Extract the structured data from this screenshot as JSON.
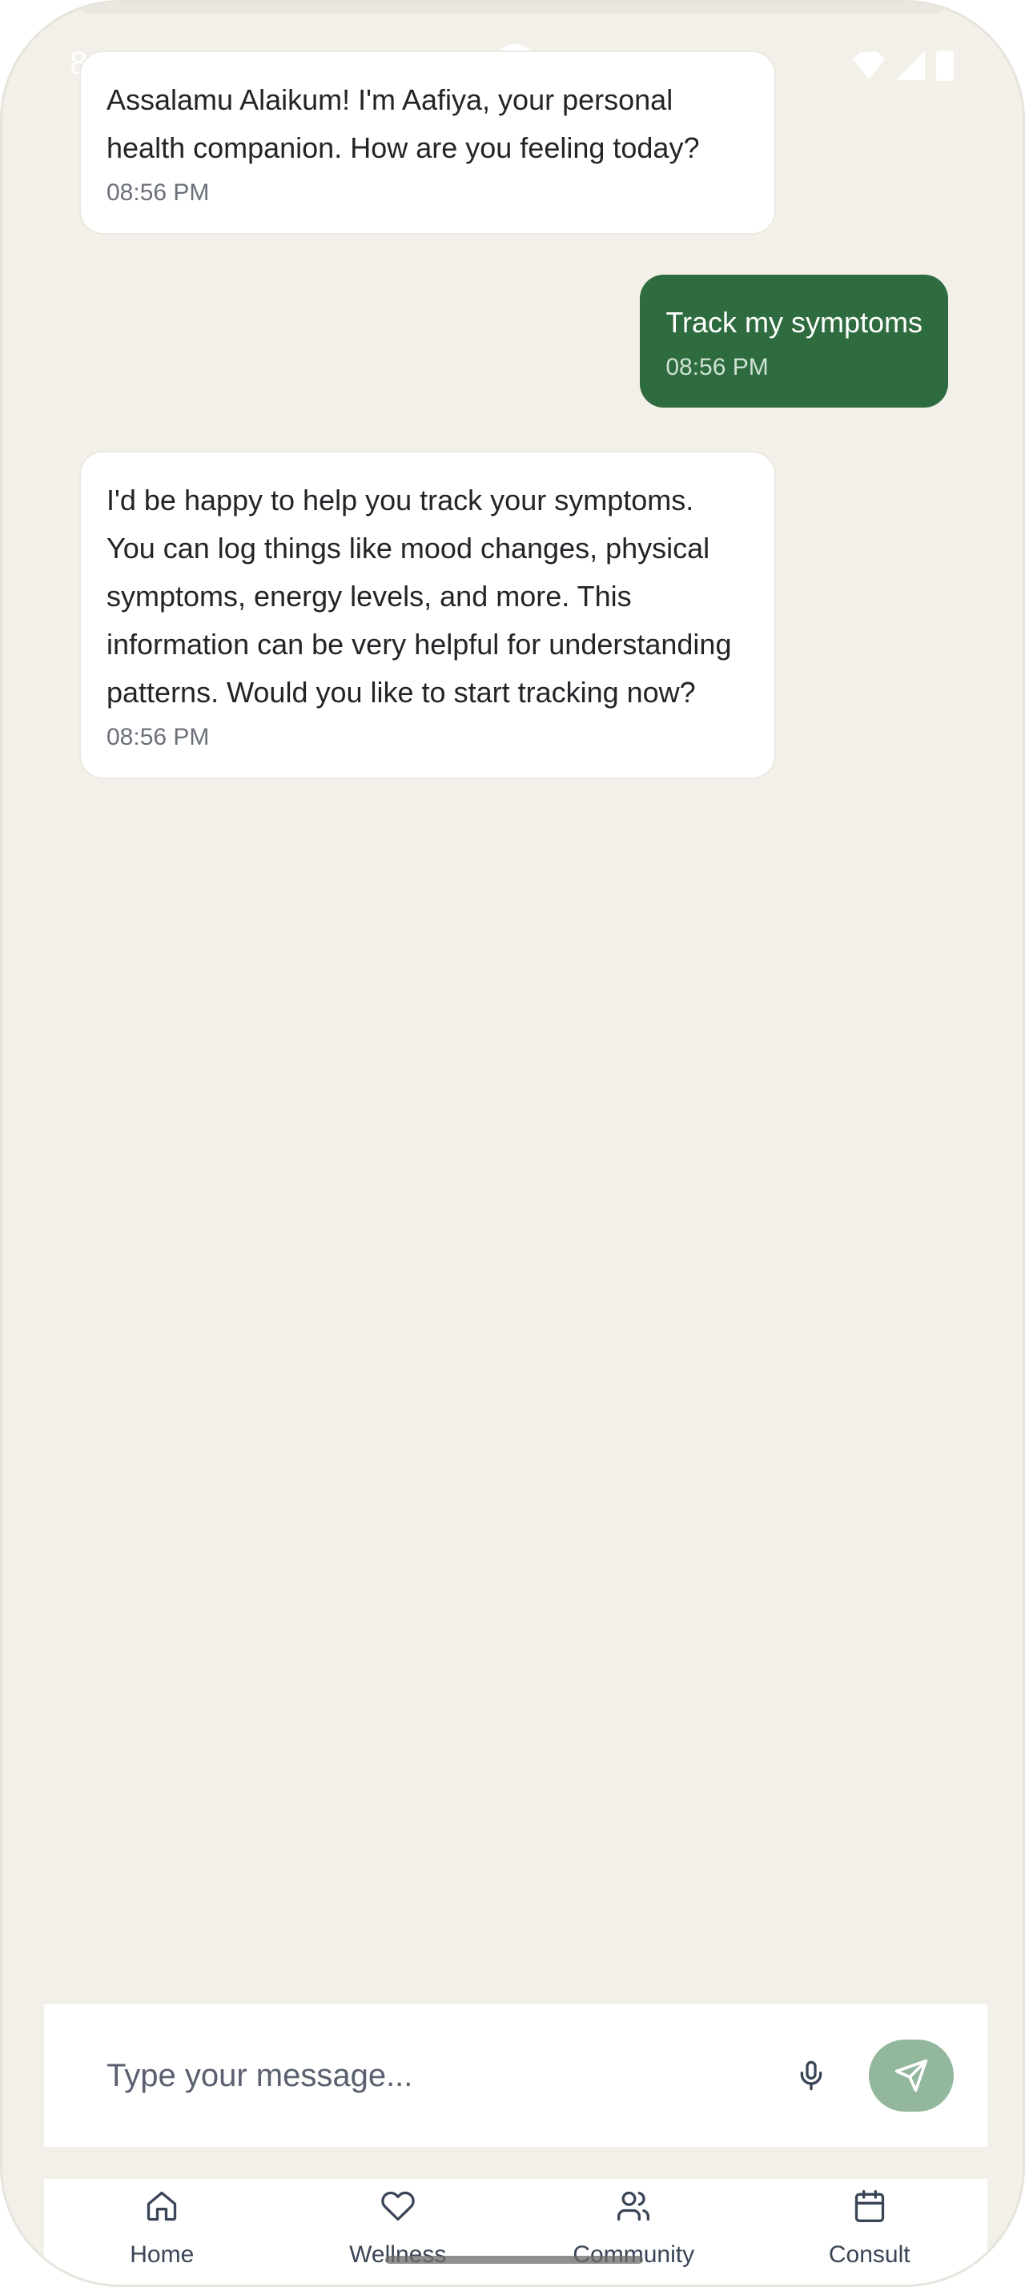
{
  "status_bar": {
    "time": "8"
  },
  "messages": [
    {
      "sender": "bot",
      "text": "Assalamu Alaikum! I'm Aafiya, your personal health companion. How are you feeling today?",
      "time": "08:56 PM"
    },
    {
      "sender": "user",
      "text": "Track my symptoms",
      "time": "08:56 PM"
    },
    {
      "sender": "bot",
      "text": "I'd be happy to help you track your symptoms. You can log things like mood changes, physical symptoms, energy levels, and more. This information can be very helpful for understanding patterns. Would you like to start tracking now?",
      "time": "08:56 PM"
    }
  ],
  "composer": {
    "placeholder": "Type your message...",
    "mic_icon": "mic-icon",
    "send_icon": "send-icon"
  },
  "nav": {
    "items": [
      {
        "label": "Home",
        "icon": "home-icon"
      },
      {
        "label": "Wellness",
        "icon": "heart-icon"
      },
      {
        "label": "Community",
        "icon": "users-icon"
      },
      {
        "label": "Consult",
        "icon": "calendar-icon"
      }
    ]
  },
  "colors": {
    "background": "#f2f0e9",
    "user_bubble": "#2e6b3e",
    "send_button": "#93b79c",
    "nav_text": "#394556"
  }
}
